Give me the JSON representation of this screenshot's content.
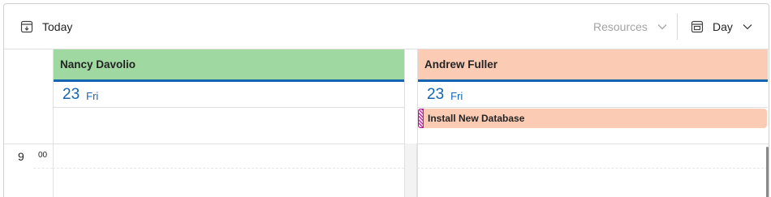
{
  "toolbar": {
    "today_label": "Today",
    "resources_label": "Resources",
    "view_label": "Day"
  },
  "resources": [
    {
      "name": "Nancy Davolio",
      "color": "#9fd8a0",
      "date_number": "23",
      "date_day": "Fri"
    },
    {
      "name": "Andrew Fuller",
      "color": "#fbcbb4",
      "date_number": "23",
      "date_day": "Fri"
    }
  ],
  "events": [
    {
      "title": "Install New Database",
      "resource": "Andrew Fuller"
    }
  ],
  "time_slots": [
    {
      "hour": "9",
      "minutes": "00"
    }
  ],
  "colors": {
    "accent": "#1464b4",
    "border": "#e0e0e0"
  }
}
